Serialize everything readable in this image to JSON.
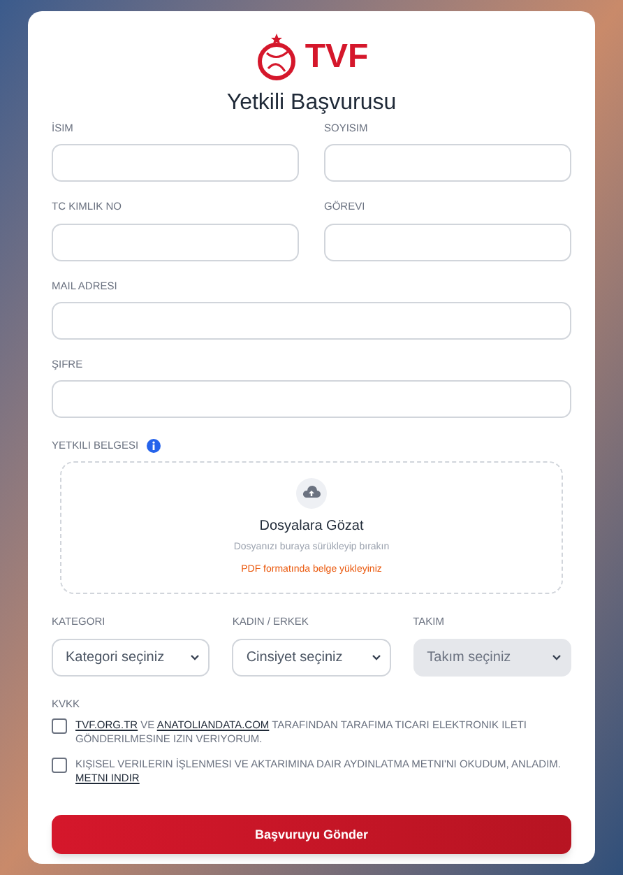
{
  "logo": {
    "text": "TVF"
  },
  "title": "Yetkili Başvurusu",
  "field_rows": [
    [
      {
        "label": "İSIM"
      },
      {
        "label": "SOYISIM"
      }
    ],
    [
      {
        "label": "TC KIMLIK NO"
      },
      {
        "label": "GÖREVI"
      }
    ],
    [
      {
        "label": "MAIL ADRESI"
      }
    ],
    [
      {
        "label": "ŞIFRE"
      }
    ]
  ],
  "upload": {
    "label": "YETKILI BELGESI",
    "heading": "Dosyalara Gözat",
    "hint": "Dosyanızı buraya sürükleyip bırakın",
    "note": "PDF formatında belge yükleyiniz"
  },
  "selects": [
    {
      "label": "KATEGORI",
      "placeholder": "Kategori seçiniz",
      "disabled": false
    },
    {
      "label": "KADIN / ERKEK",
      "placeholder": "Cinsiyet seçiniz",
      "disabled": false
    },
    {
      "label": "TAKIM",
      "placeholder": "Takım seçiniz",
      "disabled": true
    }
  ],
  "kvkk": {
    "label": "KVKK",
    "items": [
      {
        "checked": false,
        "parts": [
          {
            "kind": "link",
            "text": "TVF.ORG.TR"
          },
          {
            "kind": "text",
            "text": " VE "
          },
          {
            "kind": "link",
            "text": "ANATOLIANDATA.COM"
          },
          {
            "kind": "text",
            "text": " TARAFINDAN TARAFIMA TICARI ELEKTRONIK ILETI GÖNDERILMESINE IZIN VERIYORUM."
          }
        ]
      },
      {
        "checked": false,
        "parts": [
          {
            "kind": "text",
            "text": "KIŞISEL VERILERIN İŞLENMESI VE AKTARIMINA DAIR AYDINLATMA METNI'NI OKUDUM, ANLADIM. "
          },
          {
            "kind": "link",
            "text": "METNI INDIR"
          }
        ]
      }
    ]
  },
  "submit": "Başvuruyu Gönder"
}
